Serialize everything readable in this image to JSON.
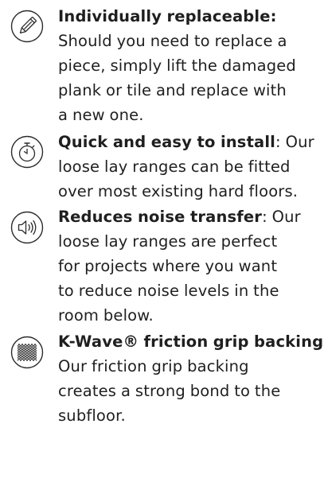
{
  "features": [
    {
      "icon": "pencil-icon",
      "title": "Individually replaceable:",
      "lines": [
        "Should you need to replace a",
        "piece, simply lift the damaged",
        "plank or tile and replace with",
        "a new one."
      ]
    },
    {
      "icon": "stopwatch-icon",
      "title": "Quick and easy to install",
      "title_suffix": ": Our",
      "lines": [
        "loose lay ranges can be fitted",
        "over most existing hard floors."
      ]
    },
    {
      "icon": "speaker-icon",
      "title": "Reduces noise transfer",
      "title_suffix": ": Our",
      "lines": [
        "loose lay ranges are perfect",
        "for projects where you want",
        "to reduce noise levels in the",
        "room below."
      ]
    },
    {
      "icon": "wave-grip-icon",
      "title": "K-Wave® friction grip backing:",
      "lines": [
        "Our friction grip backing",
        "creates a strong bond to the",
        "subfloor."
      ]
    }
  ],
  "colors": {
    "text": "#1f1f1f",
    "icon_stroke": "#2b2b2b"
  }
}
